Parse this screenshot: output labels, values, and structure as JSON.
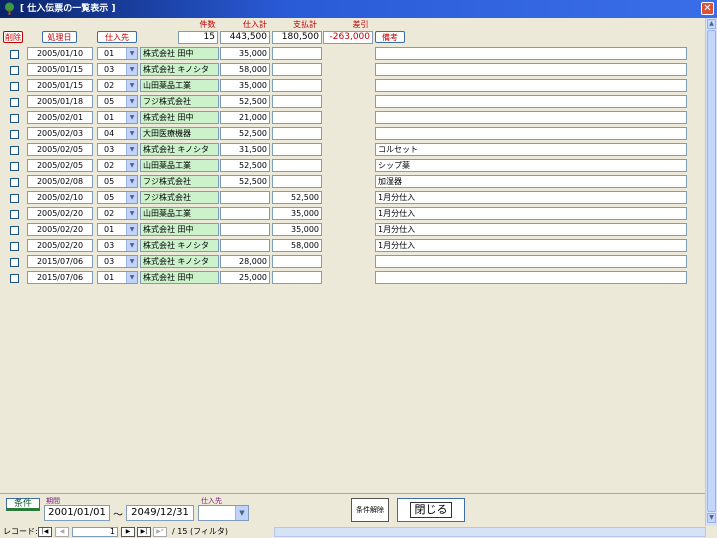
{
  "window": {
    "title": "[ 仕入伝票の一覧表示 ]"
  },
  "header": {
    "delete_label": "削除",
    "date_button": "処理日",
    "supplier_button": "仕入先",
    "count_label": "件数",
    "purchase_total_label": "仕入計",
    "payment_total_label": "支払計",
    "diff_label": "差引",
    "memo_button": "備考",
    "count": "15",
    "purchase_total": "443,500",
    "payment_total": "180,500",
    "diff": "-263,000"
  },
  "rows": [
    {
      "date": "2005/01/10",
      "code": "01",
      "name": "株式会社 田中",
      "purchase": "35,000",
      "payment": "",
      "memo": ""
    },
    {
      "date": "2005/01/15",
      "code": "03",
      "name": "株式会社 キノシタ",
      "purchase": "58,000",
      "payment": "",
      "memo": ""
    },
    {
      "date": "2005/01/15",
      "code": "02",
      "name": "山田薬品工業",
      "purchase": "35,000",
      "payment": "",
      "memo": ""
    },
    {
      "date": "2005/01/18",
      "code": "05",
      "name": "フジ株式会社",
      "purchase": "52,500",
      "payment": "",
      "memo": ""
    },
    {
      "date": "2005/02/01",
      "code": "01",
      "name": "株式会社 田中",
      "purchase": "21,000",
      "payment": "",
      "memo": ""
    },
    {
      "date": "2005/02/03",
      "code": "04",
      "name": "大田医療機器",
      "purchase": "52,500",
      "payment": "",
      "memo": ""
    },
    {
      "date": "2005/02/05",
      "code": "03",
      "name": "株式会社 キノシタ",
      "purchase": "31,500",
      "payment": "",
      "memo": "コルセット"
    },
    {
      "date": "2005/02/05",
      "code": "02",
      "name": "山田薬品工業",
      "purchase": "52,500",
      "payment": "",
      "memo": "シップ薬"
    },
    {
      "date": "2005/02/08",
      "code": "05",
      "name": "フジ株式会社",
      "purchase": "52,500",
      "payment": "",
      "memo": "加湿器"
    },
    {
      "date": "2005/02/10",
      "code": "05",
      "name": "フジ株式会社",
      "purchase": "",
      "payment": "52,500",
      "memo": "1月分仕入"
    },
    {
      "date": "2005/02/20",
      "code": "02",
      "name": "山田薬品工業",
      "purchase": "",
      "payment": "35,000",
      "memo": "1月分仕入"
    },
    {
      "date": "2005/02/20",
      "code": "01",
      "name": "株式会社 田中",
      "purchase": "",
      "payment": "35,000",
      "memo": "1月分仕入"
    },
    {
      "date": "2005/02/20",
      "code": "03",
      "name": "株式会社 キノシタ",
      "purchase": "",
      "payment": "58,000",
      "memo": "1月分仕入"
    },
    {
      "date": "2015/07/06",
      "code": "03",
      "name": "株式会社 キノシタ",
      "purchase": "28,000",
      "payment": "",
      "memo": ""
    },
    {
      "date": "2015/07/06",
      "code": "01",
      "name": "株式会社 田中",
      "purchase": "25,000",
      "payment": "",
      "memo": ""
    }
  ],
  "footer": {
    "condition_button": "条件",
    "period_label": "期間",
    "from_date": "2001/01/01",
    "tilde": "〜",
    "to_date": "2049/12/31",
    "supplier_label": "仕入先",
    "clear_button": "条件解除",
    "close_button": "閉じる"
  },
  "nav": {
    "record_label": "レコード:",
    "current": "1",
    "total": "/ 15 (フィルタ)"
  },
  "colors": {
    "title_bar": "#0a246a",
    "header_red": "#c00000",
    "supplier_bg": "#ccf2cc",
    "panel_bg": "#ece9d8"
  }
}
